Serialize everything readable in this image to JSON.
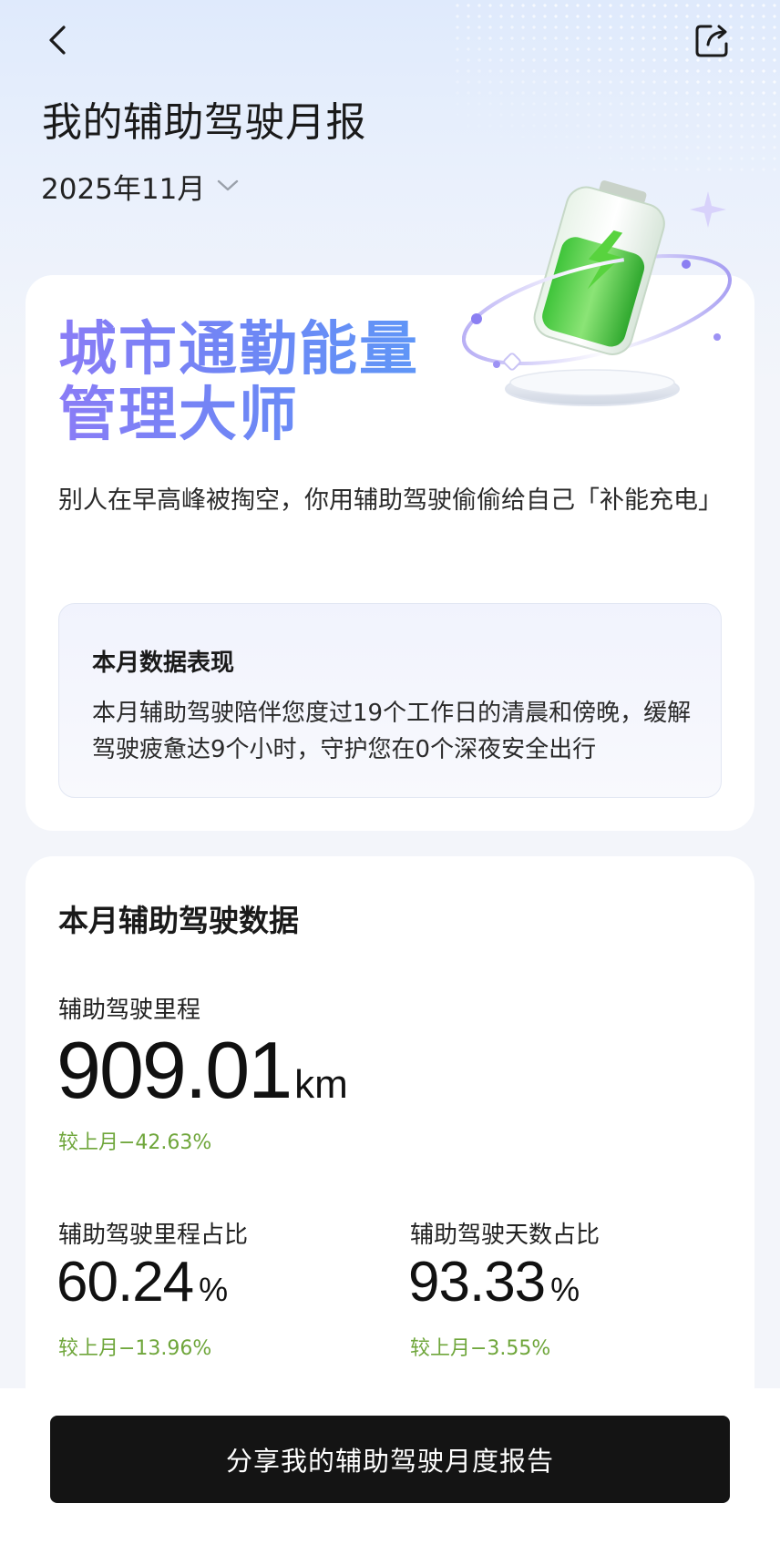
{
  "header": {
    "back_icon": "chevron-left-icon",
    "share_icon": "share-icon",
    "title": "我的辅助驾驶月报",
    "month": "2025年11月",
    "month_dropdown_icon": "chevron-down-icon"
  },
  "badge": {
    "title_line1": "城市通勤能量",
    "title_line2": "管理大师",
    "subtitle": "别人在早高峰被掏空，你用辅助驾驶偷偷给自己「补能充电」",
    "illustration_icon": "battery-charging-icon"
  },
  "highlight": {
    "title": "本月数据表现",
    "text": "本月辅助驾驶陪伴您度过19个工作日的清晨和傍晚，缓解驾驶疲惫达9个小时，守护您在0个深夜安全出行"
  },
  "stats": {
    "section_title": "本月辅助驾驶数据",
    "mileage": {
      "label": "辅助驾驶里程",
      "value": "909.01",
      "unit": "km",
      "delta": "较上月−42.63%"
    },
    "mileage_ratio": {
      "label": "辅助驾驶里程占比",
      "value": "60.24",
      "unit": "%",
      "delta": "较上月−13.96%"
    },
    "days_ratio": {
      "label": "辅助驾驶天数占比",
      "value": "93.33",
      "unit": "%",
      "delta": "较上月−3.55%"
    }
  },
  "footer": {
    "share_button": "分享我的辅助驾驶月度报告"
  },
  "colors": {
    "accent_gradient_start": "#8a7cf6",
    "accent_gradient_end": "#5f96f7",
    "delta_green": "#6fa63b",
    "cta_background": "#141414"
  }
}
